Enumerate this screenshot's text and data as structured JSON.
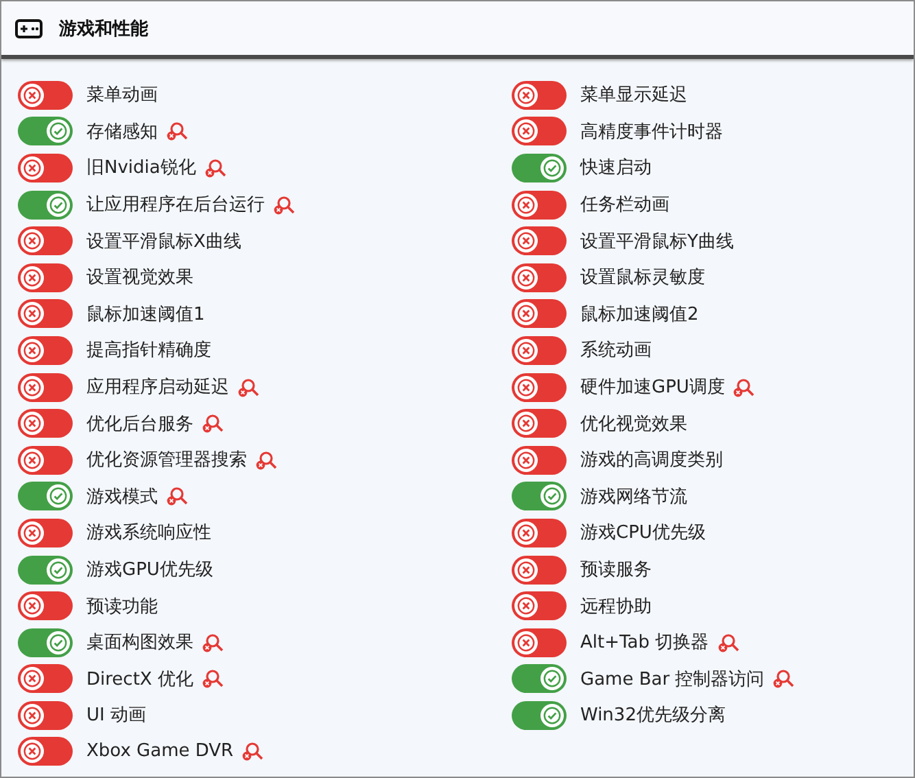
{
  "window": {
    "title": "游戏和性能"
  },
  "columns": [
    [
      {
        "label": "菜单动画",
        "on": false,
        "flagged": false
      },
      {
        "label": "存储感知",
        "on": true,
        "flagged": true
      },
      {
        "label": "旧Nvidia锐化",
        "on": false,
        "flagged": true
      },
      {
        "label": "让应用程序在后台运行",
        "on": true,
        "flagged": true
      },
      {
        "label": "设置平滑鼠标X曲线",
        "on": false,
        "flagged": false
      },
      {
        "label": "设置视觉效果",
        "on": false,
        "flagged": false
      },
      {
        "label": "鼠标加速阈值1",
        "on": false,
        "flagged": false
      },
      {
        "label": "提高指针精确度",
        "on": false,
        "flagged": false
      },
      {
        "label": "应用程序启动延迟",
        "on": false,
        "flagged": true
      },
      {
        "label": "优化后台服务",
        "on": false,
        "flagged": true
      },
      {
        "label": "优化资源管理器搜索",
        "on": false,
        "flagged": true
      },
      {
        "label": "游戏模式",
        "on": true,
        "flagged": true
      },
      {
        "label": "游戏系统响应性",
        "on": false,
        "flagged": false
      },
      {
        "label": "游戏GPU优先级",
        "on": true,
        "flagged": false
      },
      {
        "label": "预读功能",
        "on": false,
        "flagged": false
      },
      {
        "label": "桌面构图效果",
        "on": true,
        "flagged": true
      },
      {
        "label": "DirectX 优化",
        "on": false,
        "flagged": true
      },
      {
        "label": "UI 动画",
        "on": false,
        "flagged": false
      },
      {
        "label": "Xbox Game DVR",
        "on": false,
        "flagged": true
      }
    ],
    [
      {
        "label": "菜单显示延迟",
        "on": false,
        "flagged": false
      },
      {
        "label": "高精度事件计时器",
        "on": false,
        "flagged": false
      },
      {
        "label": "快速启动",
        "on": true,
        "flagged": false
      },
      {
        "label": "任务栏动画",
        "on": false,
        "flagged": false
      },
      {
        "label": "设置平滑鼠标Y曲线",
        "on": false,
        "flagged": false
      },
      {
        "label": "设置鼠标灵敏度",
        "on": false,
        "flagged": false
      },
      {
        "label": "鼠标加速阈值2",
        "on": false,
        "flagged": false
      },
      {
        "label": "系统动画",
        "on": false,
        "flagged": false
      },
      {
        "label": "硬件加速GPU调度",
        "on": false,
        "flagged": true
      },
      {
        "label": "优化视觉效果",
        "on": false,
        "flagged": false
      },
      {
        "label": "游戏的高调度类别",
        "on": false,
        "flagged": false
      },
      {
        "label": "游戏网络节流",
        "on": true,
        "flagged": false
      },
      {
        "label": "游戏CPU优先级",
        "on": false,
        "flagged": false
      },
      {
        "label": "预读服务",
        "on": false,
        "flagged": false
      },
      {
        "label": "远程协助",
        "on": false,
        "flagged": false
      },
      {
        "label": "Alt+Tab 切换器",
        "on": false,
        "flagged": true
      },
      {
        "label": "Game Bar 控制器访问",
        "on": true,
        "flagged": true
      },
      {
        "label": "Win32优先级分离",
        "on": true,
        "flagged": false
      }
    ]
  ]
}
